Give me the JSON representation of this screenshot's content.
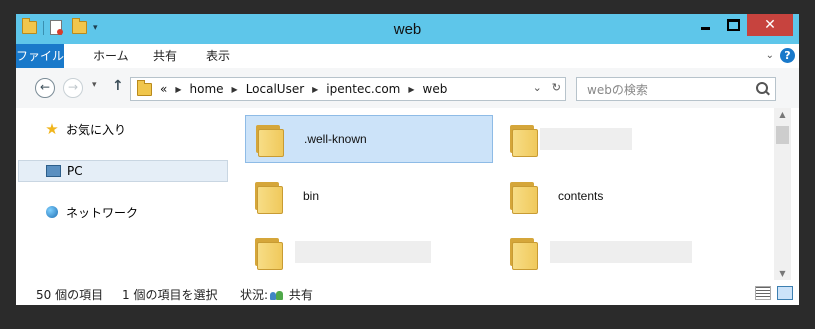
{
  "window": {
    "title": "web"
  },
  "ribbon": {
    "tabs": [
      "ファイル",
      "ホーム",
      "共有",
      "表示"
    ]
  },
  "address": {
    "prefix": "«",
    "crumbs": [
      "home",
      "LocalUser",
      "ipentec.com",
      "web"
    ]
  },
  "search": {
    "placeholder": "webの検索"
  },
  "nav_pane": {
    "favorites": "お気に入り",
    "pc": "PC",
    "network": "ネットワーク"
  },
  "files": [
    {
      "name": ".well-known"
    },
    {
      "name": ""
    },
    {
      "name": "bin"
    },
    {
      "name": "contents"
    },
    {
      "name": ""
    },
    {
      "name": ""
    }
  ],
  "status": {
    "count": "50 個の項目",
    "selected": "1 個の項目を選択",
    "state_label": "状況:",
    "state_value": "共有"
  },
  "colors": {
    "accent": "#1979ca",
    "frame": "#5ec6ea",
    "close": "#c7433e"
  }
}
